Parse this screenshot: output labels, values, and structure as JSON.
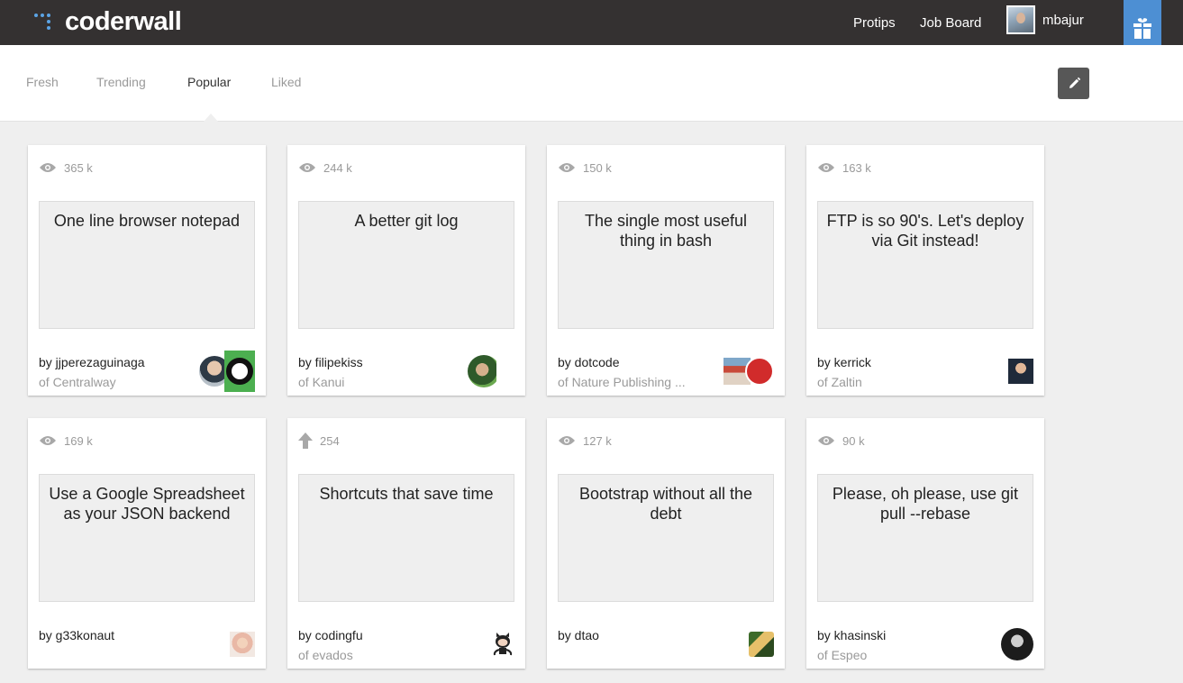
{
  "header": {
    "logo_text": "coderwall",
    "nav": [
      {
        "label": "Protips"
      },
      {
        "label": "Job Board"
      }
    ],
    "username": "mbajur",
    "brand_color": "#343131",
    "accent_color": "#4d8fd3"
  },
  "tabs": [
    {
      "label": "Fresh",
      "active": false
    },
    {
      "label": "Trending",
      "active": false
    },
    {
      "label": "Popular",
      "active": true
    },
    {
      "label": "Liked",
      "active": false
    }
  ],
  "toolbar": {
    "edit_icon": "pencil-icon"
  },
  "cards": [
    {
      "stat_icon": "eye-icon",
      "stat": "365 k",
      "title": "One line browser notepad",
      "author": "by jjperezaguinaga",
      "team": "of Centralway"
    },
    {
      "stat_icon": "eye-icon",
      "stat": "244 k",
      "title": "A better git log",
      "author": "by filipekiss",
      "team": "of Kanui"
    },
    {
      "stat_icon": "eye-icon",
      "stat": "150 k",
      "title": "The single most useful thing in bash",
      "author": "by dotcode",
      "team": "of Nature Publishing ..."
    },
    {
      "stat_icon": "eye-icon",
      "stat": "163 k",
      "title": "FTP is so 90's. Let's deploy via Git instead!",
      "author": "by kerrick",
      "team": "of Zaltin"
    },
    {
      "stat_icon": "eye-icon",
      "stat": "169 k",
      "title": "Use a Google Spreadsheet as your JSON backend",
      "author": "by g33konaut",
      "team": ""
    },
    {
      "stat_icon": "arrow-up-icon",
      "stat": "254",
      "title": "Shortcuts that save time",
      "author": "by codingfu",
      "team": "of evados"
    },
    {
      "stat_icon": "eye-icon",
      "stat": "127 k",
      "title": "Bootstrap without all the debt",
      "author": "by dtao",
      "team": ""
    },
    {
      "stat_icon": "eye-icon",
      "stat": "90 k",
      "title": "Please, oh please, use git pull --rebase",
      "author": "by khasinski",
      "team": "of Espeo"
    }
  ]
}
